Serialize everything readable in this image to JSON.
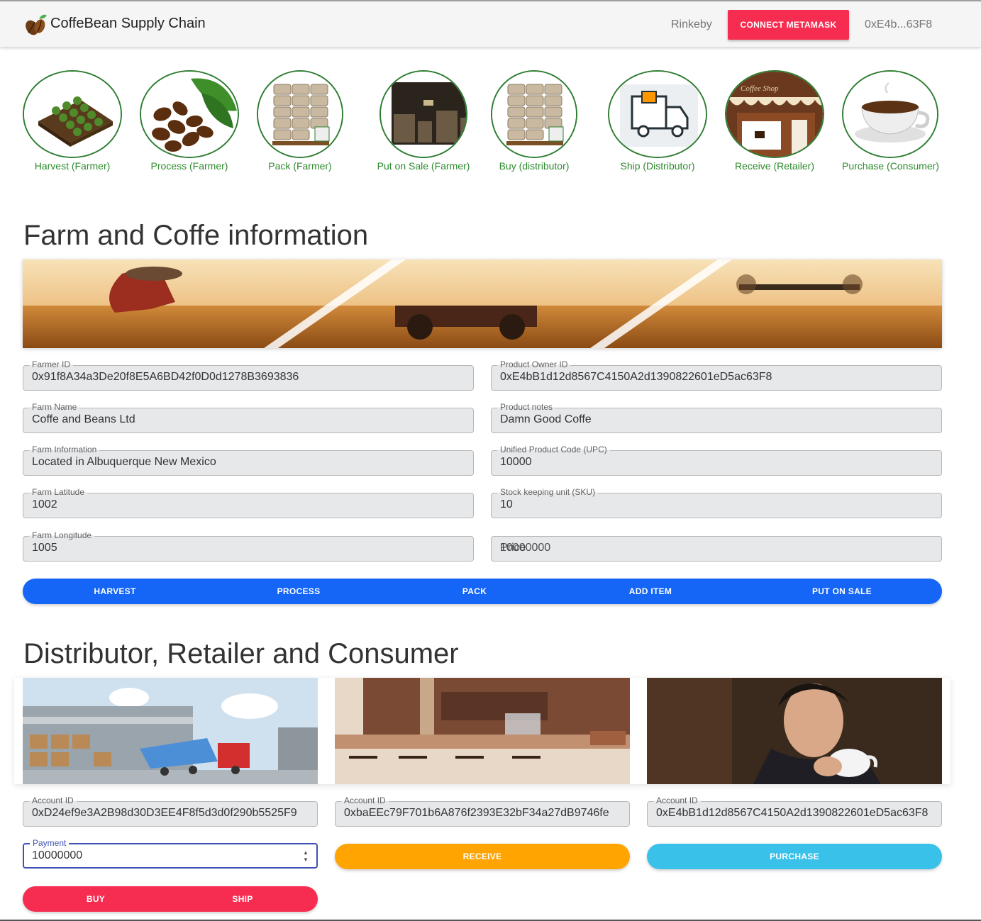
{
  "app": {
    "title": "CoffeBean Supply Chain",
    "network": "Rinkeby",
    "connect_label": "CONNECT METAMASK",
    "account": "0xE4b...63F8"
  },
  "steps": [
    {
      "label": "Harvest (Farmer)",
      "icon": "farm-field-icon"
    },
    {
      "label": "Process (Farmer)",
      "icon": "coffee-beans-icon"
    },
    {
      "label": "Pack (Farmer)",
      "icon": "coffee-sacks-icon"
    },
    {
      "label": "Put on Sale (Farmer)",
      "icon": "warehouse-icon"
    },
    {
      "label": "Buy (distributor)",
      "icon": "coffee-sacks-icon"
    },
    {
      "label": "Ship (Distributor)",
      "icon": "delivery-truck-icon"
    },
    {
      "label": "Receive (Retailer)",
      "icon": "coffee-shop-icon"
    },
    {
      "label": "Purchase (Consumer)",
      "icon": "coffee-cup-icon"
    }
  ],
  "step_images": {
    "shop_sign": "Coffee Shop"
  },
  "farm_section": {
    "title": "Farm and Coffe information",
    "fields_left": [
      {
        "label": "Farmer ID",
        "value": "0x91f8A34a3De20f8E5A6BD42f0D0d1278B3693836"
      },
      {
        "label": "Farm Name",
        "value": "Coffe and Beans Ltd"
      },
      {
        "label": "Farm Information",
        "value": "Located in Albuquerque New Mexico"
      },
      {
        "label": "Farm Latitude",
        "value": "1002"
      },
      {
        "label": "Farm Longitude",
        "value": "1005"
      }
    ],
    "fields_right": [
      {
        "label": "Product Owner ID",
        "value": "0xE4bB1d12d8567C4150A2d1390822601eD5ac63F8"
      },
      {
        "label": "Product notes",
        "value": "Damn Good Coffe"
      },
      {
        "label": "Unified Product Code (UPC)",
        "value": "10000"
      },
      {
        "label": "Stock keeping unit (SKU)",
        "value": "10"
      }
    ],
    "price_field": {
      "placeholder": "Price",
      "value": "10000000"
    },
    "actions": [
      "HARVEST",
      "PROCESS",
      "PACK",
      "ADD ITEM",
      "PUT ON SALE"
    ]
  },
  "dist_section": {
    "title": "Distributor, Retailer and Consumer",
    "distributor": {
      "account_label": "Account ID",
      "account": "0xD24ef9e3A2B98d30D3EE4F8f5d3d0f290b5525F9",
      "payment_label": "Payment",
      "payment": "10000000",
      "buy": "BUY",
      "ship": "SHIP"
    },
    "retailer": {
      "account_label": "Account ID",
      "account": "0xbaEEc79F701b6A876f2393E32bF34a27dB9746fe",
      "receive": "RECEIVE"
    },
    "consumer": {
      "account_label": "Account ID",
      "account": "0xE4bB1d12d8567C4150A2d1390822601eD5ac63F8",
      "purchase": "PURCHASE"
    }
  },
  "colors": {
    "accent_red": "#f62d51",
    "primary_blue": "#1565f6",
    "orange": "#ffa400",
    "cyan": "#39c1ea",
    "green": "#2e7d32"
  }
}
